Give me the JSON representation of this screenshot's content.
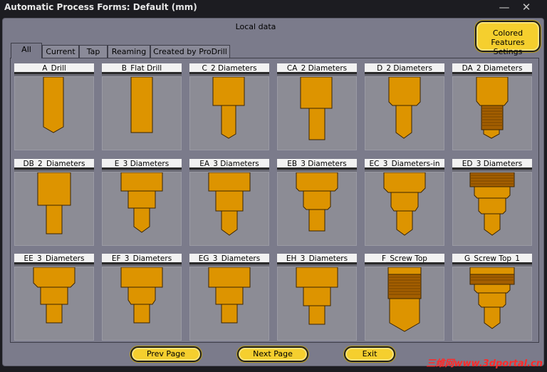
{
  "window": {
    "title": "Automatic Process Forms: Default (mm)",
    "minimize": "—",
    "close": "✕"
  },
  "header": {
    "local_data": "Local data",
    "colored_btn_line1": "Colored Features",
    "colored_btn_line2": "Setings"
  },
  "tabs": [
    "All",
    "Current",
    "Tap",
    "Reaming",
    "Created by ProDrill"
  ],
  "forms": [
    [
      "A_Drill",
      "B_Flat Drill",
      "C_2 Diameters",
      "CA_2 Diameters",
      "D_2 Diameters",
      "DA_2 Diameters"
    ],
    [
      "DB_2_Diameters",
      "E_3 Diameters",
      "EA_3 Diameters",
      "EB_3 Diameters",
      "EC_3_Diameters-in",
      "ED_3 Diameters"
    ],
    [
      "EE_3_Diameters",
      "EF_3_Diameters",
      "EG_3_Diameters",
      "EH_3_Diameters",
      "F_Screw Top",
      "G_Screw Top_1"
    ]
  ],
  "buttons": {
    "prev": "Prev Page",
    "next": "Next Page",
    "exit": "Exit"
  },
  "watermark": "三维网www.3dportal.cn",
  "colors": {
    "feature_fill": "#dd9400",
    "thread_fill": "#a35e00",
    "button_fill": "#f5cf2e",
    "panel_bg": "#7b7b8b"
  }
}
